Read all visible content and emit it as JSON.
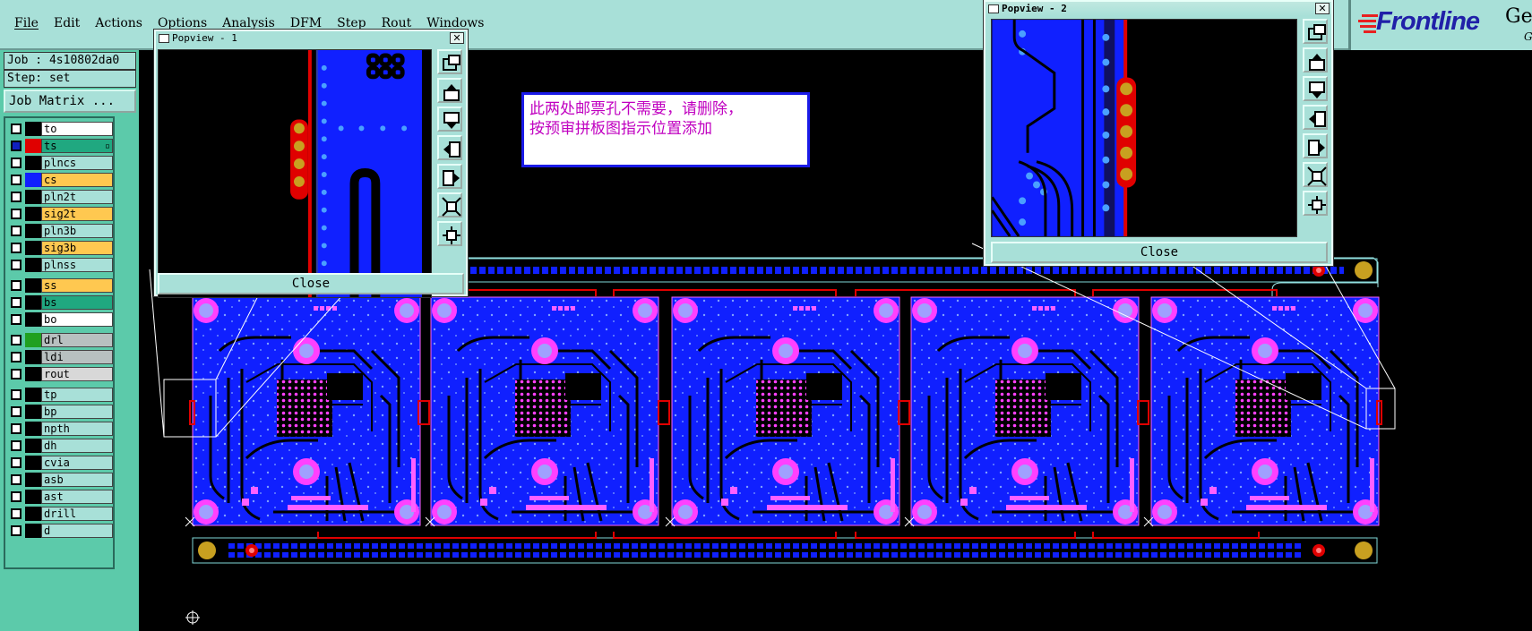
{
  "menu": [
    "File",
    "Edit",
    "Actions",
    "Options",
    "Analysis",
    "DFM",
    "Step",
    "Rout",
    "Windows"
  ],
  "logo": {
    "brand": "Frontline",
    "suffix": "Ge",
    "suffix2": "G"
  },
  "job_label": "Job : 4s10802da0",
  "step_label": "Step: set",
  "job_matrix_button": "Job Matrix ...",
  "layers": [
    {
      "name": "to",
      "bg": "#ffffff",
      "swatch": "#000000"
    },
    {
      "name": "ts",
      "bg": "#20a880",
      "swatch": "#e00000",
      "active": true
    },
    {
      "name": "plncs",
      "bg": "#a8e0d8",
      "swatch": "#000000"
    },
    {
      "name": "cs",
      "bg": "#ffc850",
      "swatch": "#1020ff"
    },
    {
      "name": "pln2t",
      "bg": "#a8e0d8",
      "swatch": "#000000"
    },
    {
      "name": "sig2t",
      "bg": "#ffc850",
      "swatch": "#000000"
    },
    {
      "name": "pln3b",
      "bg": "#a8e0d8",
      "swatch": "#000000"
    },
    {
      "name": "sig3b",
      "bg": "#ffc850",
      "swatch": "#000000"
    },
    {
      "name": "plnss",
      "bg": "#a8e0d8",
      "swatch": "#000000"
    },
    {
      "name": "ss",
      "bg": "#ffc850",
      "swatch": "#000000"
    },
    {
      "name": "bs",
      "bg": "#20a880",
      "swatch": "#000000"
    },
    {
      "name": "bo",
      "bg": "#ffffff",
      "swatch": "#000000"
    },
    {
      "name": "drl",
      "bg": "#b8c0c0",
      "swatch": "#20a020"
    },
    {
      "name": "ldi",
      "bg": "#b8c0c0",
      "swatch": "#000000"
    },
    {
      "name": "rout",
      "bg": "#d8d8d8",
      "swatch": "#000000"
    },
    {
      "name": "tp",
      "bg": "#a8e0d8",
      "swatch": "#000000"
    },
    {
      "name": "bp",
      "bg": "#a8e0d8",
      "swatch": "#000000"
    },
    {
      "name": "npth",
      "bg": "#a8e0d8",
      "swatch": "#000000"
    },
    {
      "name": "dh",
      "bg": "#a8e0d8",
      "swatch": "#000000"
    },
    {
      "name": "cvia",
      "bg": "#a8e0d8",
      "swatch": "#000000"
    },
    {
      "name": "asb",
      "bg": "#a8e0d8",
      "swatch": "#000000"
    },
    {
      "name": "ast",
      "bg": "#a8e0d8",
      "swatch": "#000000"
    },
    {
      "name": "drill",
      "bg": "#a8e0d8",
      "swatch": "#000000"
    },
    {
      "name": "d",
      "bg": "#a8e0d8",
      "swatch": "#000000"
    }
  ],
  "popup1": {
    "title": "Popview - 1",
    "close_label": "Close"
  },
  "popup2": {
    "title": "Popview - 2",
    "close_label": "Close"
  },
  "annotation": {
    "line1": "此两处邮票孔不需要，请删除，",
    "line2": "按预审拼板图指示位置添加"
  },
  "colors": {
    "ui_bg": "#a8e0d8",
    "panel_bg": "#5ccaaa",
    "board": "#1020ff",
    "copper_red": "#e00000",
    "pad_magenta": "#ff40ff",
    "mark_gold": "#c8a020",
    "annotation_text": "#c000c0",
    "annotation_border": "#1a1ae8"
  },
  "icons": [
    "zoom-window-icon",
    "pan-up-icon",
    "pan-down-icon",
    "pan-left-icon",
    "pan-right-icon",
    "zoom-fit-icon",
    "zoom-home-icon"
  ]
}
